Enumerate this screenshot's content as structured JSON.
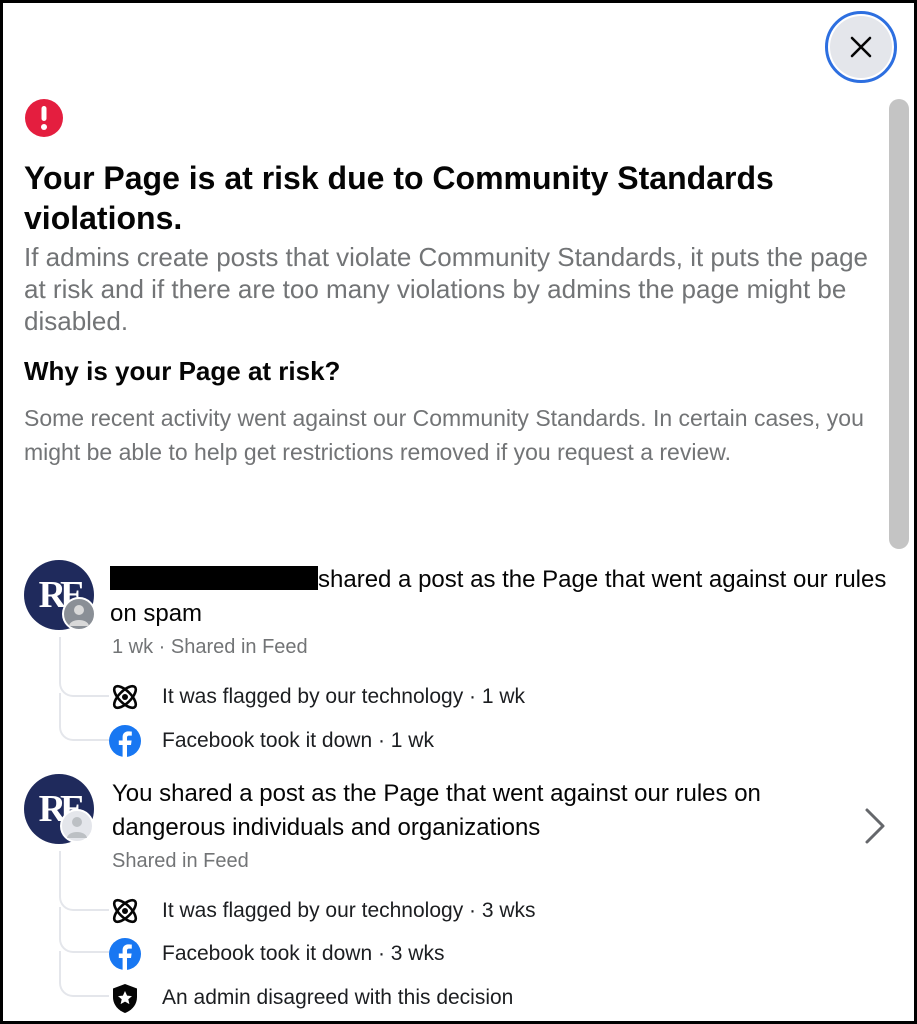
{
  "dialog": {
    "title": "Your Page is at risk due to Community Standards violations.",
    "intro": "If admins create posts that violate Community Standards, it puts the page at risk and if there are too many violations by admins the page might be disabled.",
    "subheading": "Why is your Page at risk?",
    "description": "Some recent activity went against our Community Standards. In certain cases, you might be able to help get restrictions removed if you request a review."
  },
  "colors": {
    "alert": "#e41e3f",
    "facebook_blue": "#1877f2",
    "avatar_bg": "#1f2a5c",
    "secondary_text": "#727476"
  },
  "icons": {
    "close": "close-icon",
    "alert": "exclamation-circle-icon",
    "technology": "atom-icon",
    "facebook": "facebook-logo-icon",
    "admin": "shield-star-icon",
    "chevron": "chevron-right-icon"
  },
  "violations": [
    {
      "avatar_initials": "RE",
      "title_suffix": "shared a post as the Page that went against our rules on spam",
      "meta": "1 wk · Shared in Feed",
      "steps": [
        {
          "text": "It was flagged by our technology · 1 wk"
        },
        {
          "text": "Facebook took it down · 1 wk"
        }
      ]
    },
    {
      "avatar_initials": "RE",
      "title": "You shared a post as the Page that went against our rules on dangerous individuals and organizations",
      "meta": "Shared in Feed",
      "steps": [
        {
          "text": "It was flagged by our technology · 3 wks"
        },
        {
          "text": "Facebook took it down · 3 wks"
        },
        {
          "text": "An admin disagreed with this decision"
        }
      ]
    }
  ]
}
